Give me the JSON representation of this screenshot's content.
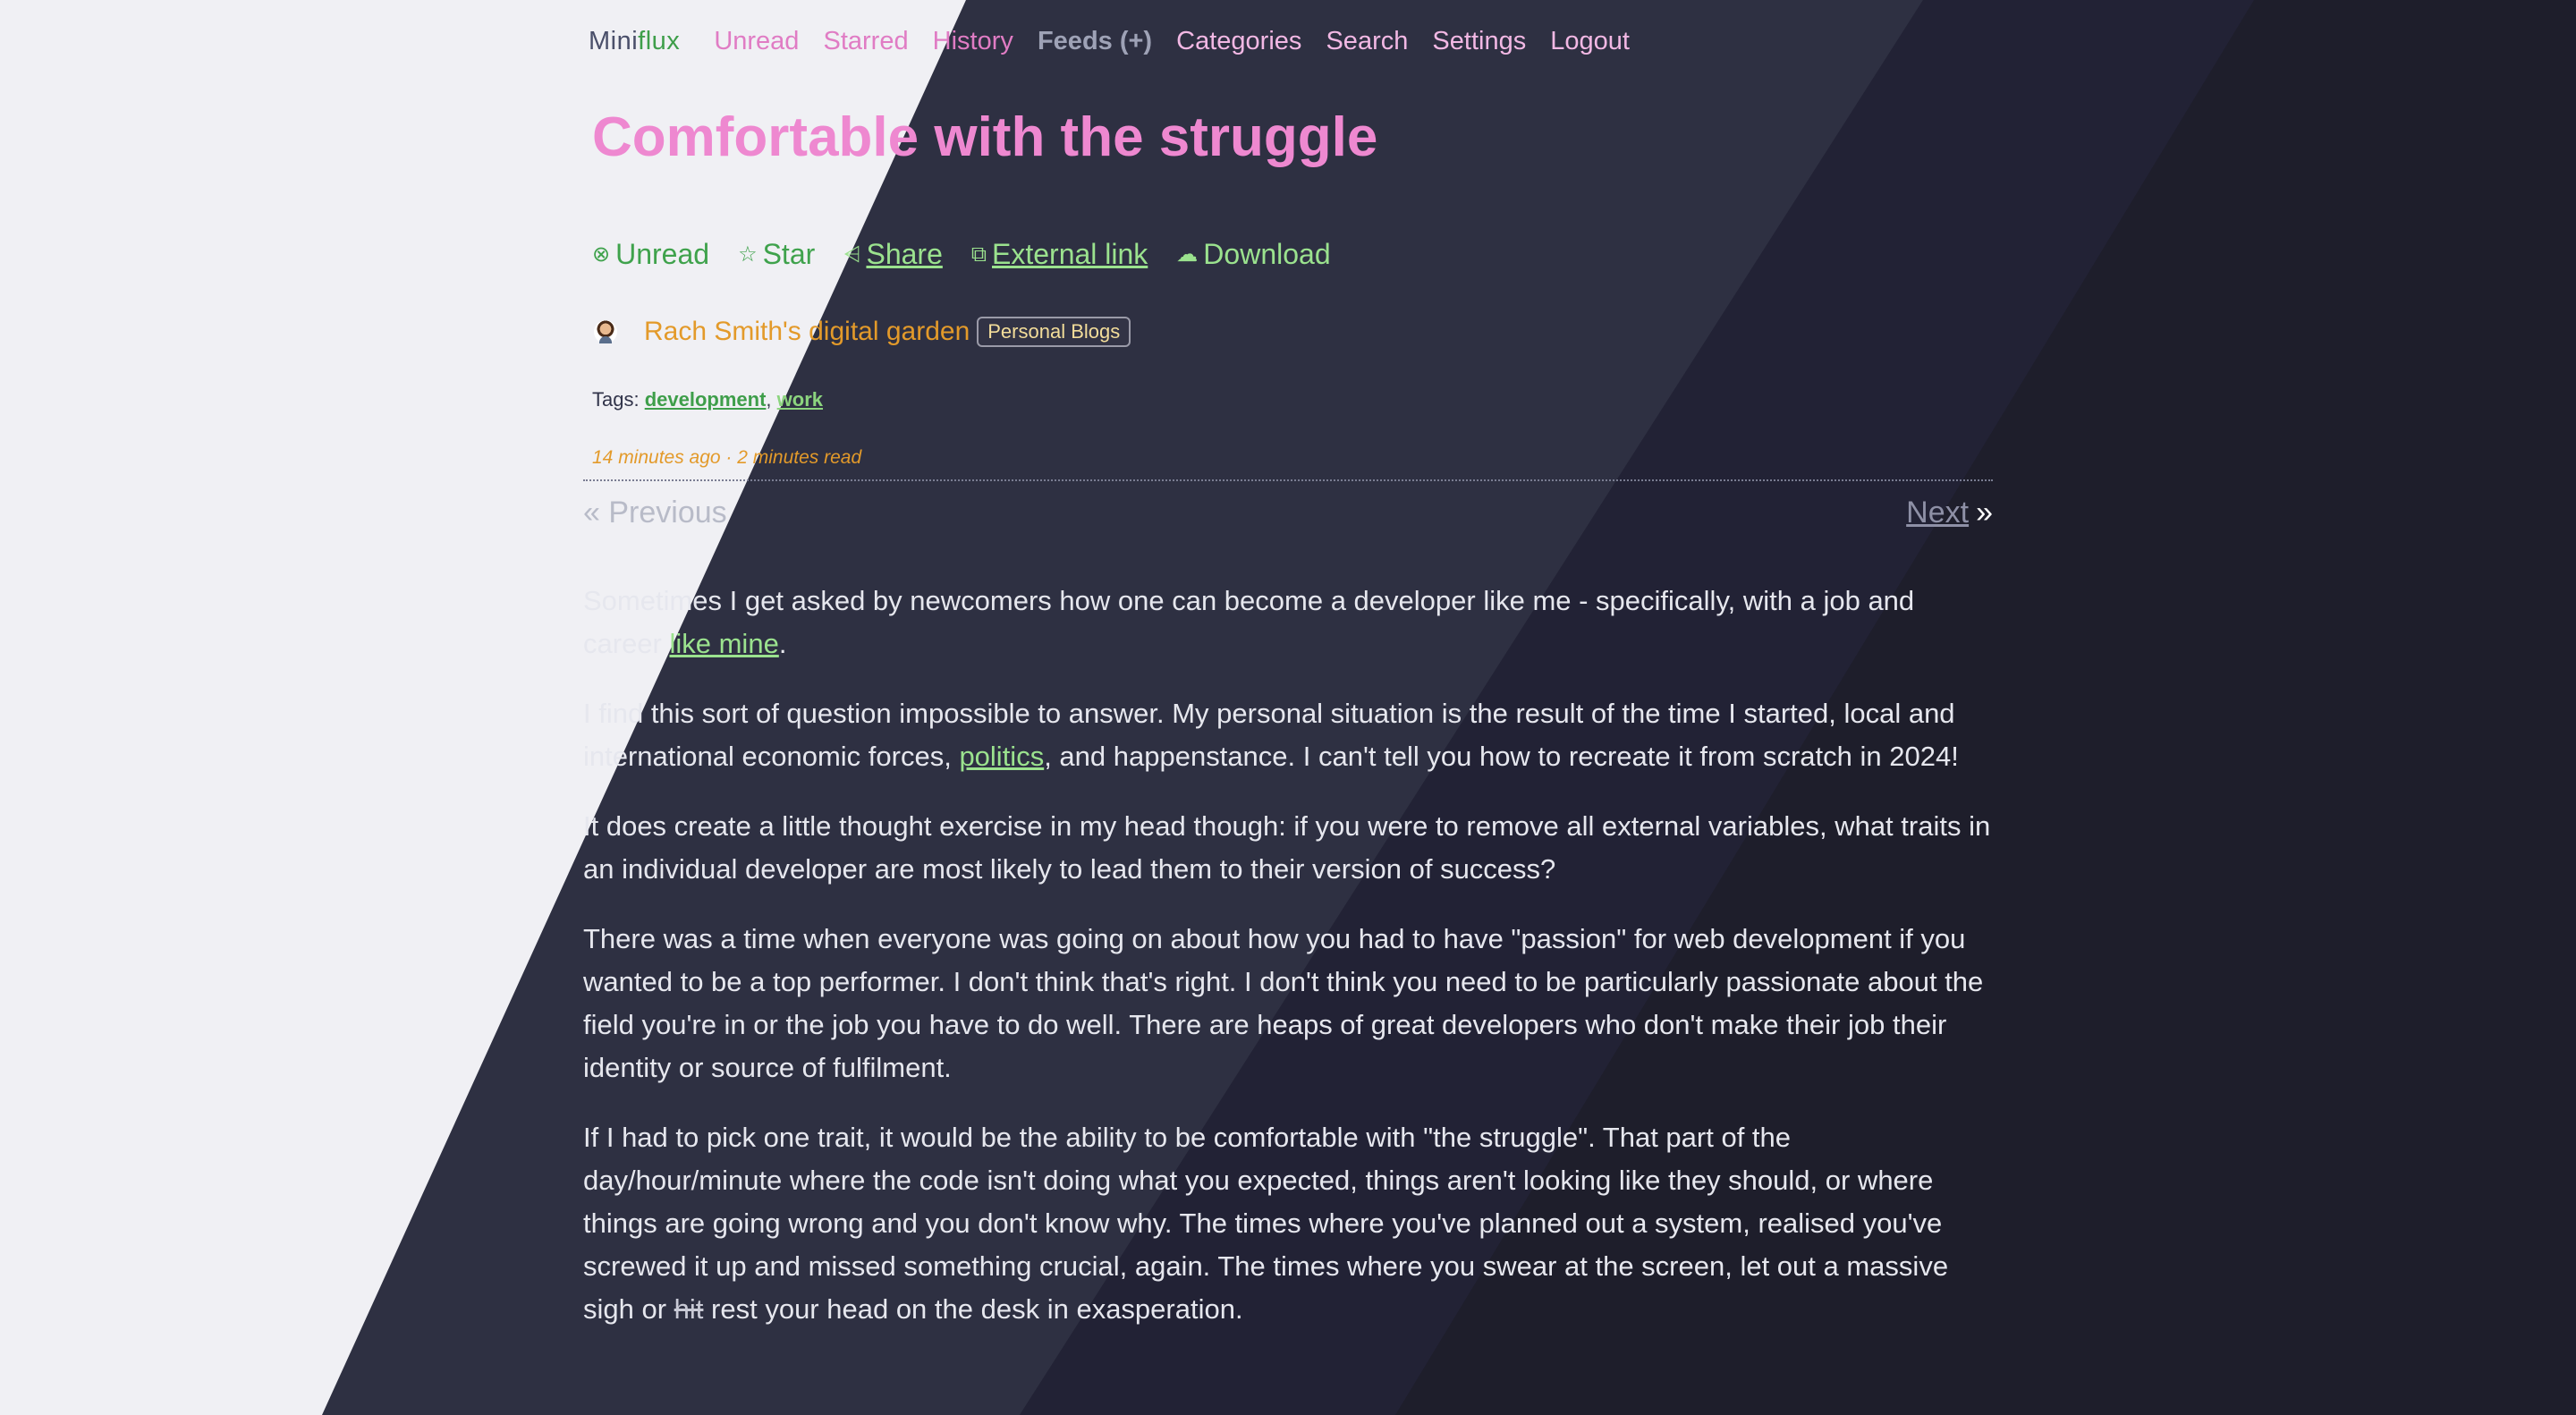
{
  "app": {
    "logo_mini": "Mini",
    "logo_flux": "flux"
  },
  "nav": {
    "unread": "Unread",
    "starred": "Starred",
    "history": "History",
    "feeds": "Feeds (+)",
    "categories": "Categories",
    "search": "Search",
    "settings": "Settings",
    "logout": "Logout"
  },
  "entry": {
    "title": "Comfortable with the struggle",
    "actions": {
      "unread": "Unread",
      "star": "Star",
      "share": "Share",
      "external": "External link",
      "download": "Download"
    },
    "feed_name": "Rach Smith's digital garden",
    "category": "Personal Blogs",
    "tags_label": "Tags:",
    "tags": [
      "development",
      "work"
    ],
    "meta": "14 minutes ago · 2 minutes read"
  },
  "pager": {
    "previous": "« Previous",
    "next": "Next",
    "next_arrow": "»"
  },
  "content": {
    "p1_a": "Sometimes I get asked by newcomers how one can become a developer like me - specifically, with a job and career ",
    "p1_link": "like mine",
    "p1_b": ".",
    "p2_a": "I find this sort of question impossible to answer. My personal situation is the result of the time I started, local and international economic forces, ",
    "p2_link": "politics",
    "p2_b": ", and happenstance. I can't tell you how to recreate it from scratch in 2024!",
    "p3": "It does create a little thought exercise in my head though: if you were to remove all external variables, what traits in an individual developer are most likely to lead them to their version of success?",
    "p4": "There was a time when everyone was going on about how you had to have \"passion\" for web development if you wanted to be a top performer. I don't think that's right. I don't think you need to be particularly passionate about the field you're in or the job you have to do well. There are heaps of great developers who don't make their job their identity or source of fulfilment.",
    "p5_a": "If I had to pick one trait, it would be the ability to be comfortable with \"the struggle\". That part of the day/hour/minute where the code isn't doing what you expected, things aren't looking like they should, or where things are going wrong and you don't know why. The times where you've planned out a system, realised you've screwed it up and missed something crucial, again. The times where you swear at the screen, let out a massive sigh or ",
    "p5_strike": "hit",
    "p5_b": " rest your head on the desk in exasperation."
  },
  "colors": {
    "light_bg": "#f0f0f4",
    "dark_band_1": "#2e3040",
    "dark_band_2": "#262737",
    "dark_band_3": "#1f1f2c",
    "title": "#ee88d0",
    "link": "#9be28e",
    "meta": "#e39a2a"
  }
}
